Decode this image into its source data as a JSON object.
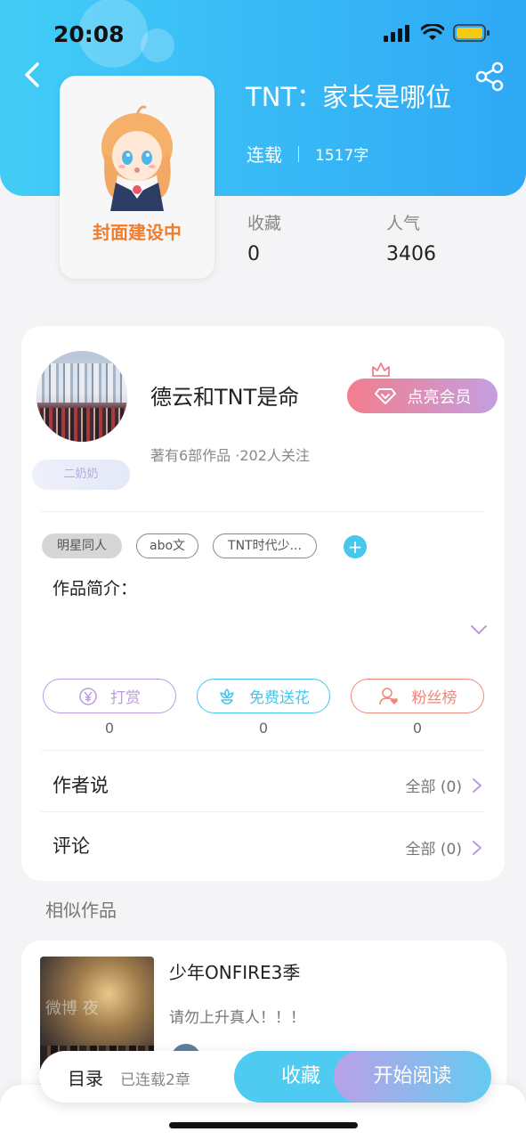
{
  "status_bar": {
    "time": "20:08"
  },
  "header": {
    "cover_placeholder": "封面建设中",
    "title": "TNT：家长是哪位",
    "status": "连载",
    "word_count": "1517字"
  },
  "stats": [
    {
      "label": "收藏",
      "value": "0"
    },
    {
      "label": "人气",
      "value": "3406"
    }
  ],
  "author": {
    "name": "德云和TNT是命",
    "info": "著有6部作品 ·202人关注",
    "badge": "二奶奶",
    "vip_button": "点亮会员"
  },
  "tags": [
    "明星同人",
    "abo文",
    "TNT时代少..."
  ],
  "intro_label": "作品简介：",
  "actions": [
    {
      "label": "打赏",
      "count": "0",
      "color": "#b99be0",
      "icon": "yen-icon"
    },
    {
      "label": "免费送花",
      "count": "0",
      "color": "#45c7ee",
      "icon": "flower-icon"
    },
    {
      "label": "粉丝榜",
      "count": "0",
      "color": "#f0867a",
      "icon": "fan-rank-icon"
    }
  ],
  "rows": {
    "author_says": {
      "label": "作者说",
      "right": "全部 (0)"
    },
    "comments": {
      "label": "评论",
      "right": "全部 (0)"
    }
  },
  "similar": {
    "title": "相似作品",
    "item": {
      "name": "少年ONFIRE3季",
      "desc": "请勿上升真人！！！",
      "cover_text": "微博 夜"
    }
  },
  "bottom_bar": {
    "toc": "目录",
    "chapters": "已连载2章",
    "collect": "收藏",
    "read": "开始阅读"
  },
  "colors": {
    "header_start": "#42cdf6",
    "header_end": "#2fa8f5",
    "vip": "#f37d8e",
    "accent_blue": "#45c7ee"
  }
}
